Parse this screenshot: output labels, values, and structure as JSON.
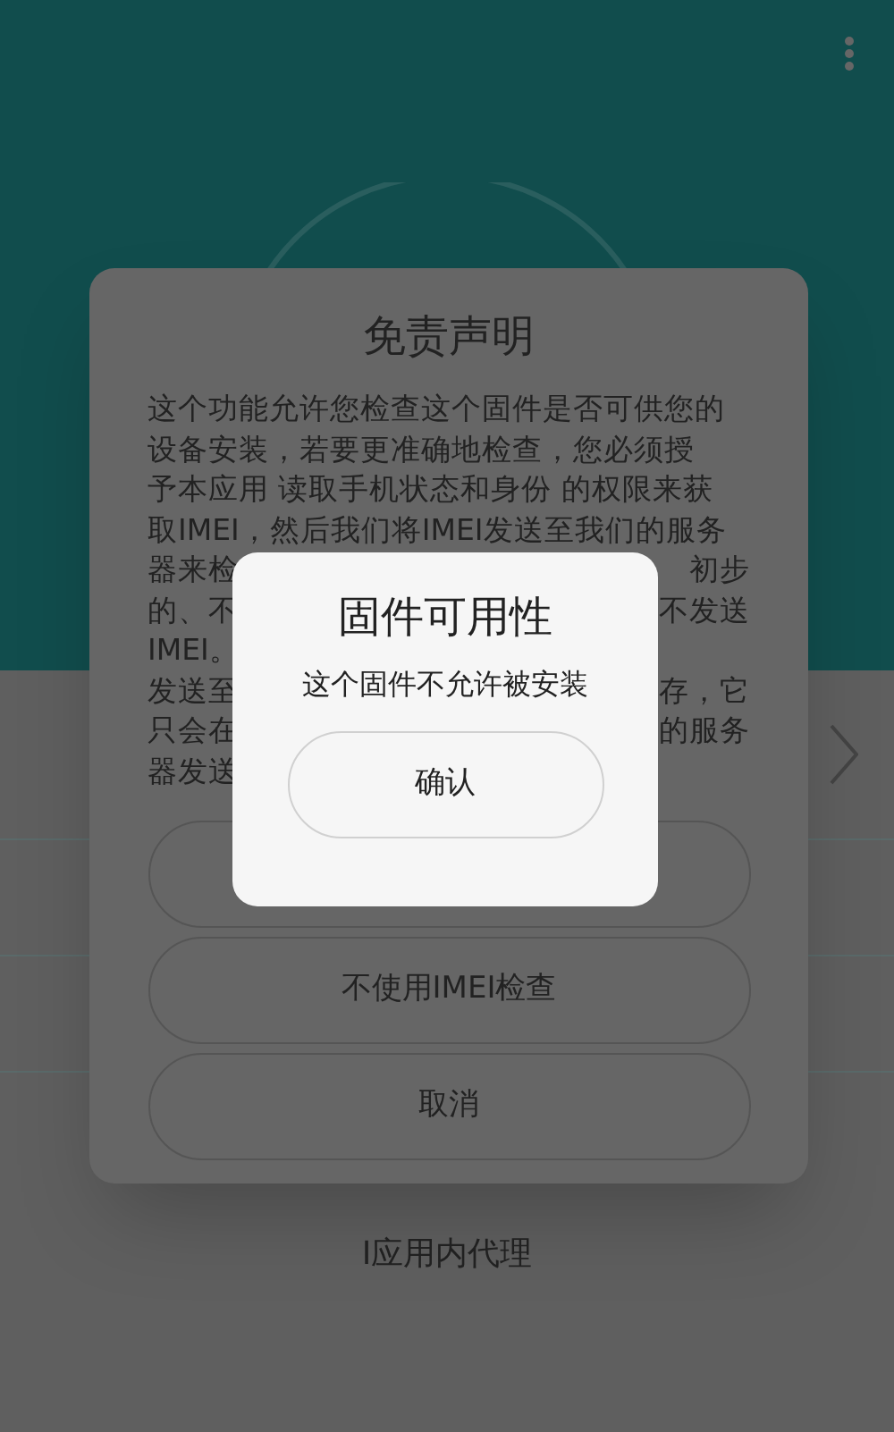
{
  "background": {
    "bottom_label": "I应用内代理"
  },
  "disclaimer": {
    "title": "免责声明",
    "lines": [
      {
        "left": "这个功能允许您检查这个固件是否可供您的"
      },
      {
        "left": "设备安装，若要更准确地检查，您必须授"
      },
      {
        "left": "予本应用 读取手机状态和身份 的权限来获"
      },
      {
        "left": "取IMEI，然后我们将IMEI发送至我们的服务"
      },
      {
        "left": "器来检",
        "right": "初步"
      },
      {
        "left": "的、不",
        "right": "不发送"
      },
      {
        "left": "IMEI。"
      },
      {
        "left": "发送至",
        "right": "存，它"
      },
      {
        "left": "只会在",
        "right": "的服务"
      },
      {
        "left": "器发送"
      }
    ],
    "buttons": [
      {
        "kind": "outline"
      },
      {
        "kind": "outline",
        "label": "不使用IMEI检查"
      },
      {
        "kind": "outline",
        "label": "取消"
      }
    ]
  },
  "dialog": {
    "title": "固件可用性",
    "message": "这个固件不允许被安装",
    "button": "确认"
  }
}
